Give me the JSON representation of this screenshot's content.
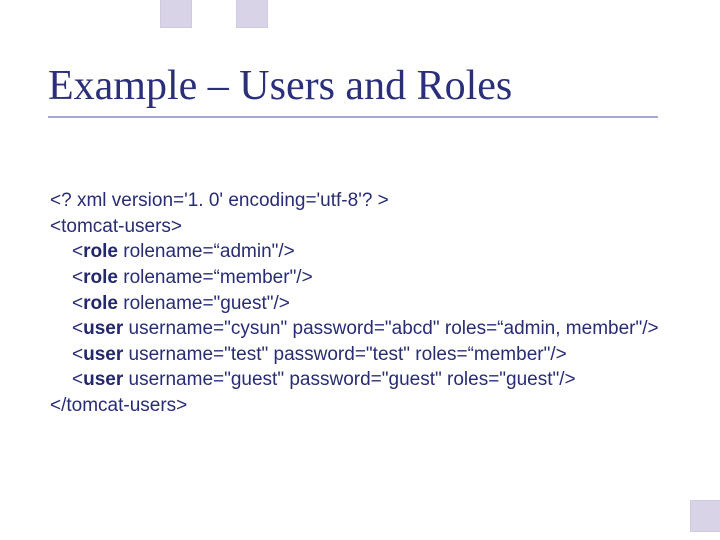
{
  "title": "Example – Users and Roles",
  "xml": {
    "declaration": "<? xml version='1. 0' encoding='utf-8'? >",
    "open_root": "<tomcat-users>",
    "role_open": "<",
    "role_tag": "role",
    "role1_rest": " rolename=“admin\"/>",
    "role2_rest": " rolename=“member\"/>",
    "role3_rest": " rolename=\"guest\"/>",
    "user_open": "<",
    "user_tag": "user",
    "user1_rest": " username=\"cysun\" password=\"abcd\" roles=“admin, member\"/>",
    "user2_rest": " username=\"test\" password=\"test\" roles=“member\"/>",
    "user3_rest": " username=\"guest\" password=\"guest\" roles=\"guest\"/>",
    "close_root": "</tomcat-users>"
  }
}
